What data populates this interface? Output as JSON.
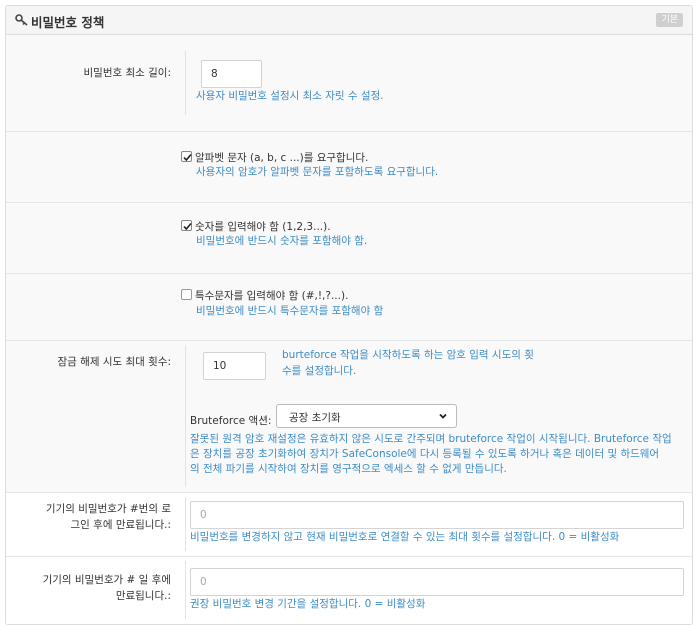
{
  "header": {
    "icon": "key-icon",
    "title": "비밀번호 정책",
    "badge": "기본"
  },
  "min_length": {
    "label": "비밀번호 최소 길이:",
    "value": "8",
    "help": "사용자 비밀번호 설정시 최소 자릿 수 설정."
  },
  "alpha": {
    "checked": true,
    "label": "알파벳 문자 (a, b, c ...)를 요구합니다.",
    "help": "사용자의 암호가 알파벳 문자를 포함하도록 요구합니다."
  },
  "numeric": {
    "checked": true,
    "label": "숫자를 입력해야 함 (1,2,3...).",
    "help": "비밀번호에 반드시 숫자를 포함해야 함."
  },
  "special": {
    "checked": false,
    "label": "특수문자를 입력해야 함 (#,!,?...).",
    "help": "비밀번호에 반드시 특수문자를 포함해야 함"
  },
  "unlock": {
    "label": "잠금 해제 시도 최대 횟수:",
    "value": "10",
    "help_line1": "burteforce 작업을 시작하도록 하는 암호 입력 시도의 횟",
    "help_line2": "수를 설정합니다.",
    "action_label": "Bruteforce 액션:",
    "action_value": "공장 초기화",
    "action_help_line1": "잘못된 원격 암호 재설정은 유효하지 않은 시도로 간주되며 bruteforce 작업이 시작됩니다. Bruteforce 작업",
    "action_help_line2": "은 장치를 공장 초기화하여 장치가 SafeConsole에 다시 등록될 수 있도록 하거나 혹은 데이터 및 하드웨어",
    "action_help_line3": "의 전체 파기를 시작하여 장치를 영구적으로 엑세스 할 수 없게 만듭니다."
  },
  "expire_logins": {
    "label_line1": "기기의 비밀번호가 #번의 로",
    "label_line2": "그인 후에 만료됩니다.:",
    "placeholder": "0",
    "help": "비밀번호를 변경하지 않고 현재 비밀번호로 연결할 수 있는 최대 횟수를 설정합니다. 0 = 비활성화"
  },
  "expire_days": {
    "label_line1": "기기의 비밀번호가 # 일 후에",
    "label_line2": "만료됩니다.:",
    "placeholder": "0",
    "help": "권장 비밀번호 변경 기간을 설정합니다. 0 = 비활성화"
  }
}
